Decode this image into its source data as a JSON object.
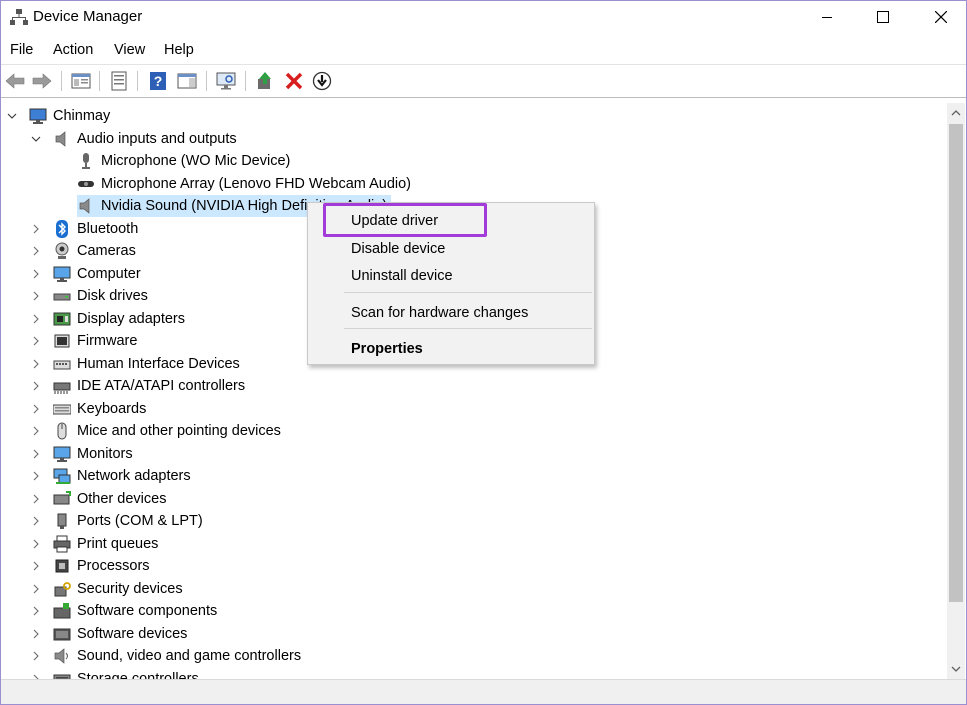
{
  "window": {
    "title": "Device Manager",
    "controls": [
      "minimize",
      "maximize",
      "close"
    ]
  },
  "menubar": {
    "items": [
      "File",
      "Action",
      "View",
      "Help"
    ]
  },
  "toolbar": {
    "icons": [
      "back-arrow-icon",
      "forward-arrow-icon",
      "show-hide-console-tree-icon",
      "properties-icon",
      "help-icon",
      "action-pane-icon",
      "scan-hardware-icon",
      "update-driver-icon",
      "uninstall-icon",
      "download-icon"
    ]
  },
  "tree": {
    "root": "Chinmay",
    "audio_group": "Audio inputs and outputs",
    "audio_children": [
      "Microphone (WO Mic Device)",
      "Microphone Array (Lenovo FHD Webcam Audio)",
      "Nvidia Sound (NVIDIA High Definition Audio)"
    ],
    "categories": [
      "Bluetooth",
      "Cameras",
      "Computer",
      "Disk drives",
      "Display adapters",
      "Firmware",
      "Human Interface Devices",
      "IDE ATA/ATAPI controllers",
      "Keyboards",
      "Mice and other pointing devices",
      "Monitors",
      "Network adapters",
      "Other devices",
      "Ports (COM & LPT)",
      "Print queues",
      "Processors",
      "Security devices",
      "Software components",
      "Software devices",
      "Sound, video and game controllers",
      "Storage controllers"
    ]
  },
  "context_menu": {
    "items": [
      "Update driver",
      "Disable device",
      "Uninstall device",
      "Scan for hardware changes",
      "Properties"
    ]
  },
  "colors": {
    "highlight": "#a23cd8",
    "selection": "#cce8ff"
  }
}
